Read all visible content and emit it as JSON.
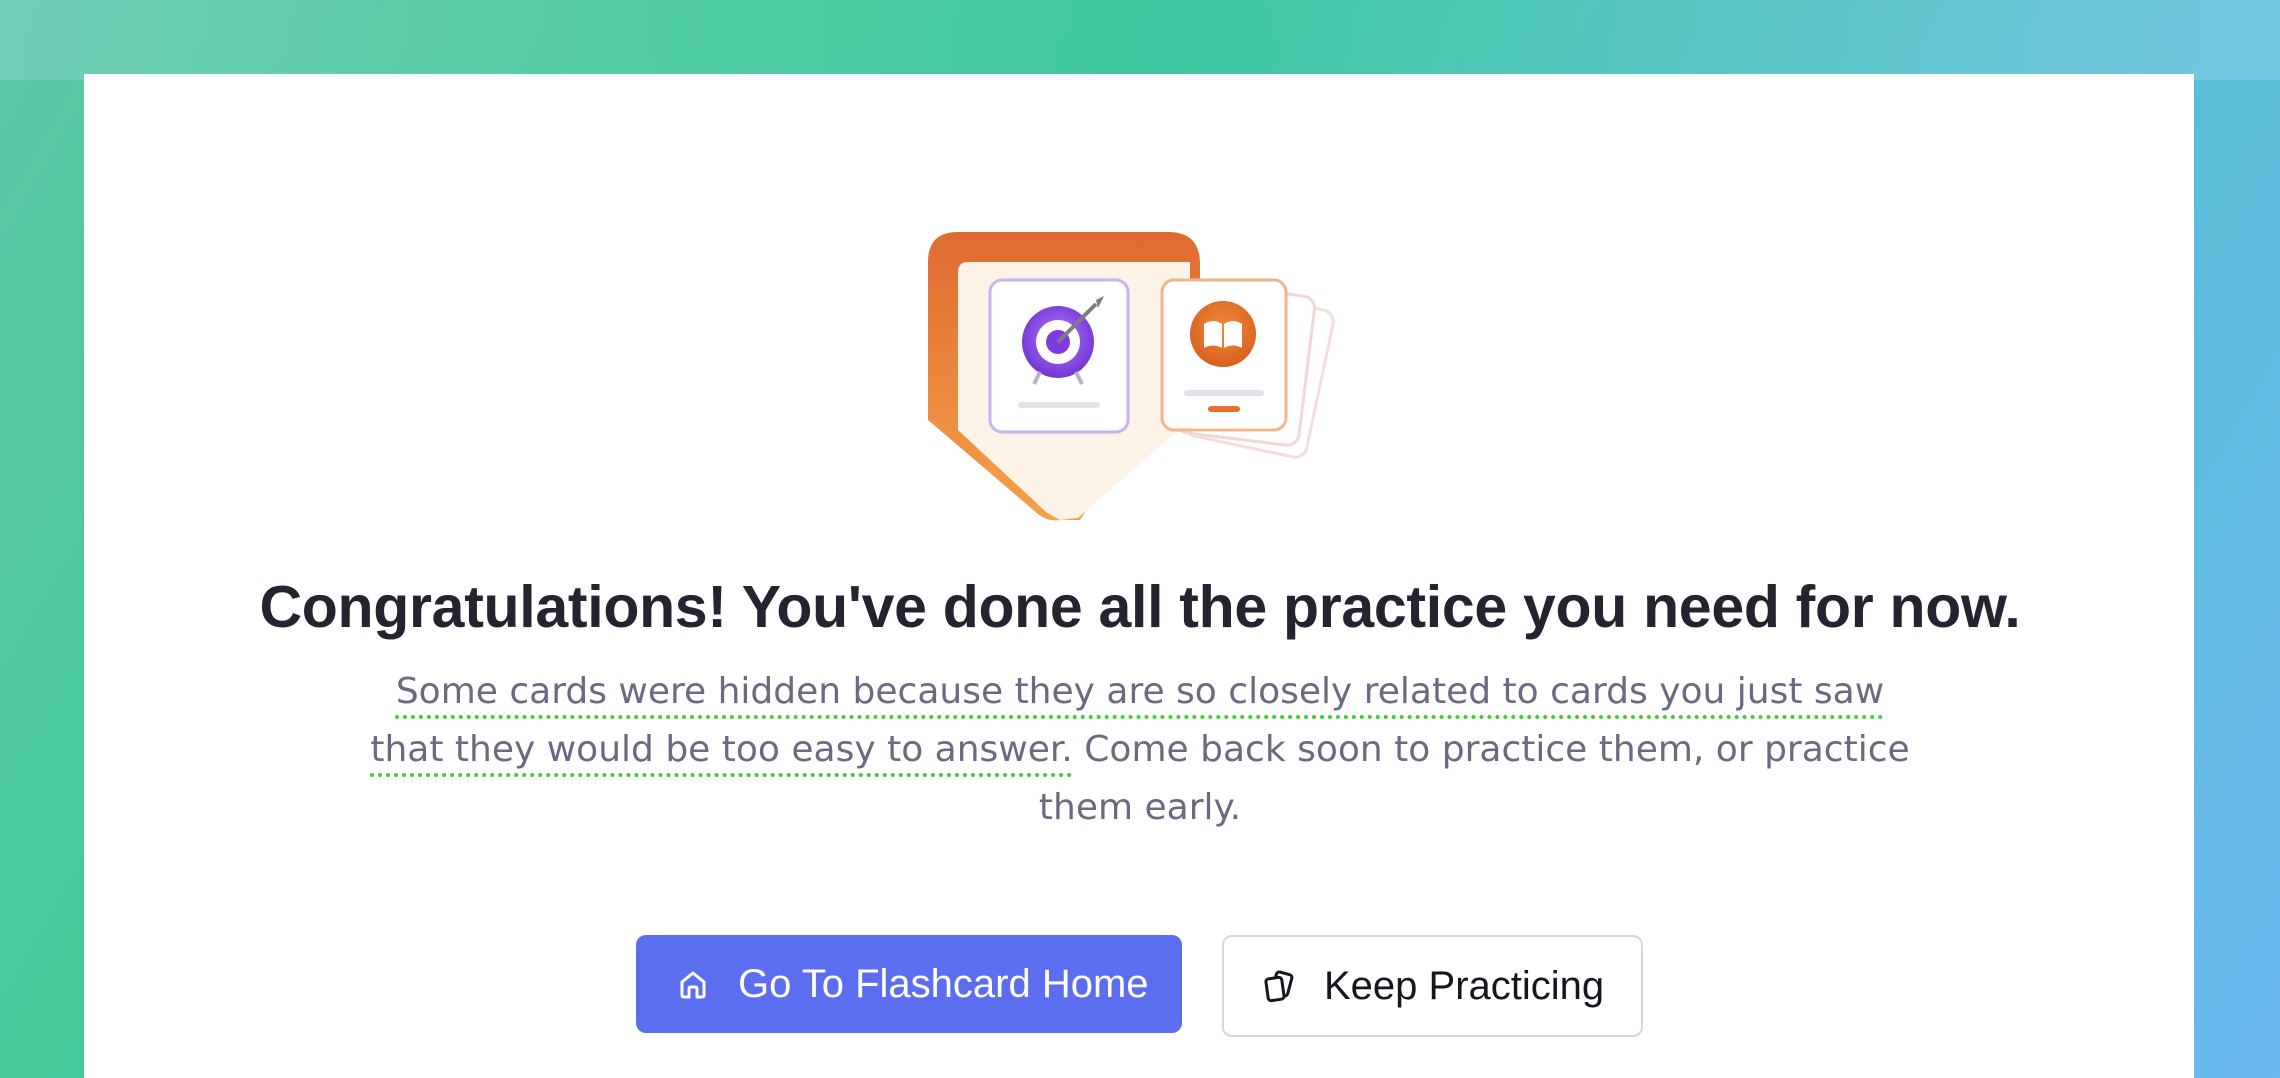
{
  "page": {
    "headline": "Congratulations! You've done all the practice you need for now.",
    "subtext": {
      "underlined": "Some cards were hidden because they are so closely related to cards you just saw that they would be too easy to answer.",
      "rest": " Come back soon to practice them, or practice them early."
    }
  },
  "buttons": {
    "home": {
      "label": "Go To Flashcard Home",
      "icon": "home-icon"
    },
    "keep": {
      "label": "Keep Practicing",
      "icon": "cards-icon"
    }
  },
  "colors": {
    "primary": "#5b6ef0",
    "accent_orange": "#e8702d",
    "accent_purple": "#8a4fe0",
    "spellcheck": "#3ccf3c"
  }
}
